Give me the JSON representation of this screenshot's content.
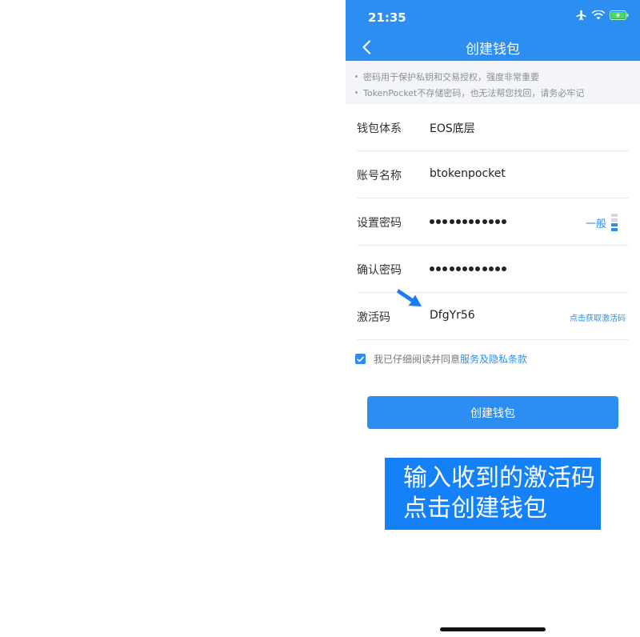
{
  "status_bar": {
    "time": "21:35"
  },
  "header": {
    "title": "创建钱包"
  },
  "notices": [
    "密码用于保护私钥和交易授权，强度非常重要",
    "TokenPocket不存储密码，也无法帮您找回，请务必牢记"
  ],
  "form": {
    "wallet_system": {
      "label": "钱包体系",
      "value": "EOS底层"
    },
    "account_name": {
      "label": "账号名称",
      "value": "btokenpocket"
    },
    "set_password": {
      "label": "设置密码",
      "dot_count": 12,
      "strength_label": "一般",
      "strength_level": 2,
      "strength_max": 4
    },
    "confirm_password": {
      "label": "确认密码",
      "dot_count": 12
    },
    "activation_code": {
      "label": "激活码",
      "value": "DfgYr56",
      "get_code_link": "点击获取激活码"
    }
  },
  "agreement": {
    "checked": true,
    "text": "我已仔细阅读并同意",
    "link": "服务及隐私条款"
  },
  "create_button": {
    "label": "创建钱包"
  },
  "caption": {
    "line1": "输入收到的激活码",
    "line2": "点击创建钱包"
  },
  "colors": {
    "accent": "#2c8ef0",
    "caption_bg": "#1481f8",
    "notice_bg": "#f4f5f9"
  }
}
